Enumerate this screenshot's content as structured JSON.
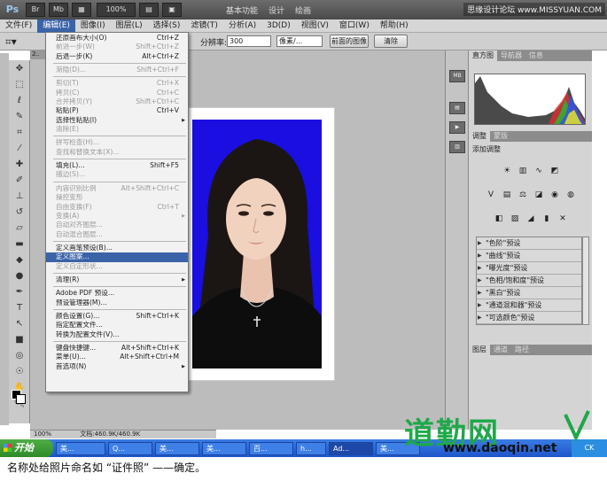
{
  "app": {
    "logo": "Ps",
    "zoom": "100%",
    "workspaces": [
      "基本功能",
      "设计",
      "绘画"
    ],
    "top_watermark": "思缘设计论坛 www.MISSYUAN.COM"
  },
  "menubar": [
    {
      "label": "文件(F)",
      "active": false
    },
    {
      "label": "编辑(E)",
      "active": true
    },
    {
      "label": "图像(I)",
      "active": false
    },
    {
      "label": "图层(L)",
      "active": false
    },
    {
      "label": "选择(S)",
      "active": false
    },
    {
      "label": "滤镜(T)",
      "active": false
    },
    {
      "label": "分析(A)",
      "active": false
    },
    {
      "label": "3D(D)",
      "active": false
    },
    {
      "label": "视图(V)",
      "active": false
    },
    {
      "label": "窗口(W)",
      "active": false
    },
    {
      "label": "帮助(H)",
      "active": false
    }
  ],
  "options_bar": {
    "resolution_label": "分辨率:",
    "resolution_value": "300",
    "unit_select": "像素/...",
    "front_image_button": "前面的图像",
    "clear_button": "清除"
  },
  "edit_menu": [
    {
      "label": "还原画布大小(O)",
      "shortcut": "Ctrl+Z",
      "disabled": false
    },
    {
      "label": "前进一步(W)",
      "shortcut": "Shift+Ctrl+Z",
      "disabled": true
    },
    {
      "label": "后退一步(K)",
      "shortcut": "Alt+Ctrl+Z",
      "disabled": false
    },
    {
      "sep": true
    },
    {
      "label": "渐隐(D)...",
      "shortcut": "Shift+Ctrl+F",
      "disabled": true
    },
    {
      "sep": true
    },
    {
      "label": "剪切(T)",
      "shortcut": "Ctrl+X",
      "disabled": true
    },
    {
      "label": "拷贝(C)",
      "shortcut": "Ctrl+C",
      "disabled": true
    },
    {
      "label": "合并拷贝(Y)",
      "shortcut": "Shift+Ctrl+C",
      "disabled": true
    },
    {
      "label": "粘贴(P)",
      "shortcut": "Ctrl+V",
      "disabled": false
    },
    {
      "label": "选择性粘贴(I)",
      "shortcut": "",
      "disabled": false,
      "submenu": true
    },
    {
      "label": "清除(E)",
      "shortcut": "",
      "disabled": true
    },
    {
      "sep": true
    },
    {
      "label": "拼写检查(H)...",
      "shortcut": "",
      "disabled": true
    },
    {
      "label": "查找和替换文本(X)...",
      "shortcut": "",
      "disabled": true
    },
    {
      "sep": true
    },
    {
      "label": "填充(L)...",
      "shortcut": "Shift+F5",
      "disabled": false
    },
    {
      "label": "描边(S)...",
      "shortcut": "",
      "disabled": true
    },
    {
      "sep": true
    },
    {
      "label": "内容识别比例",
      "shortcut": "Alt+Shift+Ctrl+C",
      "disabled": true
    },
    {
      "label": "操控变形",
      "shortcut": "",
      "disabled": true
    },
    {
      "label": "自由变换(F)",
      "shortcut": "Ctrl+T",
      "disabled": true
    },
    {
      "label": "变换(A)",
      "shortcut": "",
      "disabled": true,
      "submenu": true
    },
    {
      "label": "自动对齐图层...",
      "shortcut": "",
      "disabled": true
    },
    {
      "label": "自动混合图层...",
      "shortcut": "",
      "disabled": true
    },
    {
      "sep": true
    },
    {
      "label": "定义画笔预设(B)...",
      "shortcut": "",
      "disabled": false
    },
    {
      "label": "定义图案...",
      "shortcut": "",
      "disabled": false,
      "highlight": true
    },
    {
      "label": "定义自定形状...",
      "shortcut": "",
      "disabled": true
    },
    {
      "sep": true
    },
    {
      "label": "清理(R)",
      "shortcut": "",
      "disabled": false,
      "submenu": true
    },
    {
      "sep": true
    },
    {
      "label": "Adobe PDF 预设...",
      "shortcut": "",
      "disabled": false
    },
    {
      "label": "预设管理器(M)...",
      "shortcut": "",
      "disabled": false
    },
    {
      "sep": true
    },
    {
      "label": "颜色设置(G)...",
      "shortcut": "Shift+Ctrl+K",
      "disabled": false
    },
    {
      "label": "指定配置文件...",
      "shortcut": "",
      "disabled": false
    },
    {
      "label": "转换为配置文件(V)...",
      "shortcut": "",
      "disabled": false
    },
    {
      "sep": true
    },
    {
      "label": "键盘快捷键...",
      "shortcut": "Alt+Shift+Ctrl+K",
      "disabled": false
    },
    {
      "label": "菜单(U)...",
      "shortcut": "Alt+Shift+Ctrl+M",
      "disabled": false
    },
    {
      "label": "首选项(N)",
      "shortcut": "",
      "disabled": false,
      "submenu": true
    }
  ],
  "right_panel": {
    "top_tabs": [
      "直方图",
      "导航器",
      "信息"
    ],
    "adjust_tabs": [
      "调整",
      "蒙版"
    ],
    "adjust_title": "添加调整",
    "presets": [
      "\"色阶\"预设",
      "\"曲线\"预设",
      "\"曝光度\"预设",
      "\"色相/饱和度\"预设",
      "\"黑白\"预设",
      "\"通道混和器\"预设",
      "\"可选颜色\"预设"
    ],
    "bottom_tabs": [
      "图层",
      "通道",
      "路径"
    ]
  },
  "status": {
    "zoom": "100%",
    "doc": "文档:460.9K/460.9K"
  },
  "taskbar": {
    "start": "开始",
    "buttons": [
      "美...",
      "Q...",
      "美...",
      "美...",
      "百...",
      "h...",
      "Ad...",
      "美..."
    ],
    "tray": "CK"
  },
  "watermark": {
    "brand": "道勤网",
    "url": "www.daoqin.net"
  },
  "caption": "名称处给照片命名如 “证件照” ——确定。",
  "colors": {
    "menu_highlight": "#3b63a8",
    "photo_background": "#1a0ee0",
    "brand_green": "#1fa84a"
  }
}
